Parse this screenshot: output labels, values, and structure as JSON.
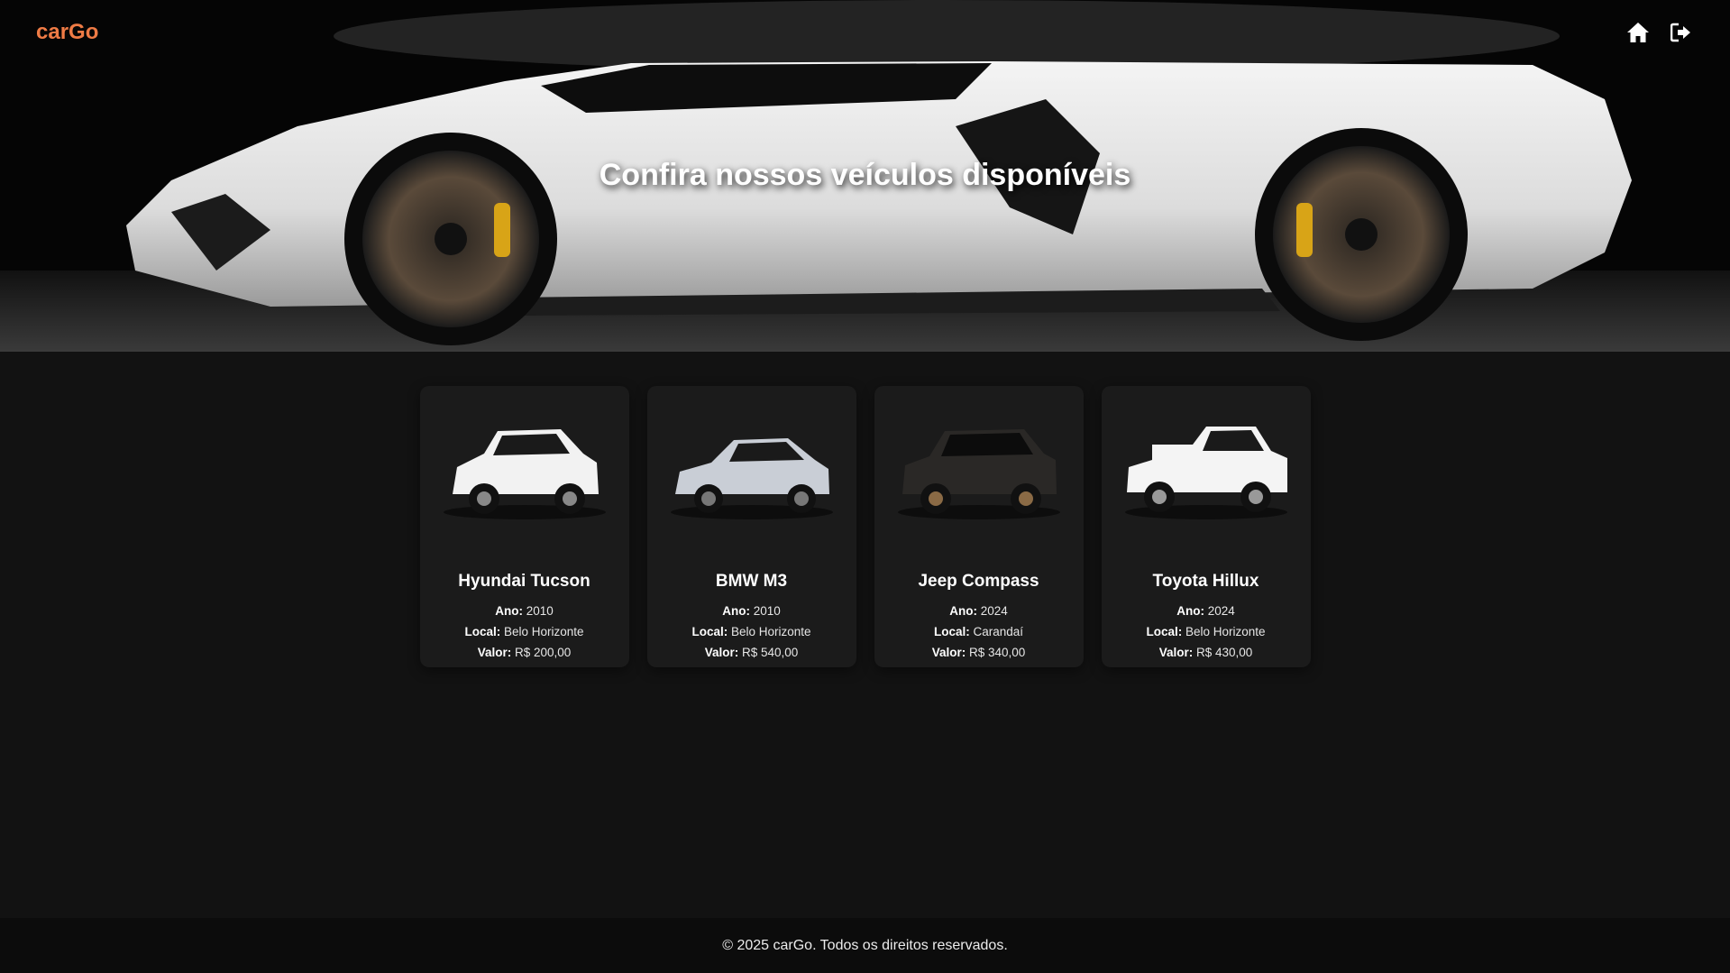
{
  "navbar": {
    "logo": "carGo",
    "brand_color": "#ef7b45",
    "icons": [
      "home-icon",
      "logout-icon"
    ]
  },
  "hero": {
    "title": "Confira nossos veículos disponíveis"
  },
  "cars": [
    {
      "name": "Hyundai Tucson",
      "year_label": "Ano:",
      "year": "2010",
      "location_label": "Local:",
      "location": "Belo Horizonte",
      "price_label": "Valor:",
      "price": "R$ 200,00",
      "color": "#f2f2f2"
    },
    {
      "name": "BMW M3",
      "year_label": "Ano:",
      "year": "2010",
      "location_label": "Local:",
      "location": "Belo Horizonte",
      "price_label": "Valor:",
      "price": "R$ 540,00",
      "color": "#c9ced6"
    },
    {
      "name": "Jeep Compass",
      "year_label": "Ano:",
      "year": "2024",
      "location_label": "Local:",
      "location": "Carandaí",
      "price_label": "Valor:",
      "price": "R$ 340,00",
      "color": "#2a2826"
    },
    {
      "name": "Toyota Hillux",
      "year_label": "Ano:",
      "year": "2024",
      "location_label": "Local:",
      "location": "Belo Horizonte",
      "price_label": "Valor:",
      "price": "R$ 430,00",
      "color": "#f4f4f4"
    }
  ],
  "footer": {
    "text": "© 2025 carGo. Todos os direitos reservados."
  }
}
